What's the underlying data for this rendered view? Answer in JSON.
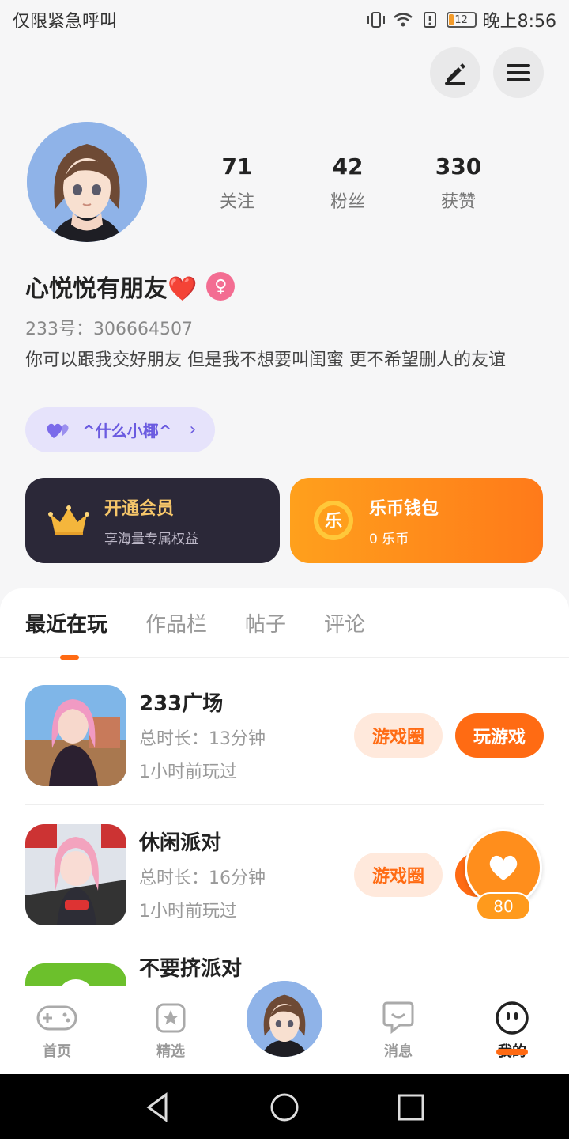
{
  "status_bar": {
    "carrier": "仅限紧急呼叫",
    "battery": "12",
    "time": "晚上8:56"
  },
  "profile": {
    "stats": [
      {
        "value": "71",
        "label": "关注"
      },
      {
        "value": "42",
        "label": "粉丝"
      },
      {
        "value": "330",
        "label": "获赞"
      }
    ],
    "nickname": "心悦悦有朋友❤️",
    "gender_symbol": "♀",
    "uid": "233号：306664507",
    "bio": "你可以跟我交好朋友 但是我不想要叫闺蜜 更不希望删人的友谊",
    "chip_label": "^什么小椰^"
  },
  "cards": {
    "vip_title": "开通会员",
    "vip_sub": "享海量专属权益",
    "coin_title": "乐币钱包",
    "coin_sub": "0 乐币",
    "coin_glyph": "乐"
  },
  "tabs": [
    "最近在玩",
    "作品栏",
    "帖子",
    "评论"
  ],
  "games": [
    {
      "name": "233广场",
      "duration": "总时长：13分钟",
      "last_played": "1小时前玩过",
      "circle_btn": "游戏圈",
      "play_btn": "玩游戏"
    },
    {
      "name": "休闲派对",
      "duration": "总时长：16分钟",
      "last_played": "1小时前玩过",
      "circle_btn": "游戏圈"
    },
    {
      "name": "不要挤派对"
    }
  ],
  "float_like": {
    "count": "80"
  },
  "bottom_nav": {
    "home": "首页",
    "featured": "精选",
    "messages": "消息",
    "mine": "我的"
  },
  "colors": {
    "accent": "#ff6b13",
    "vip_bg": "#2b2838",
    "chip_bg": "#e6e3fb"
  }
}
